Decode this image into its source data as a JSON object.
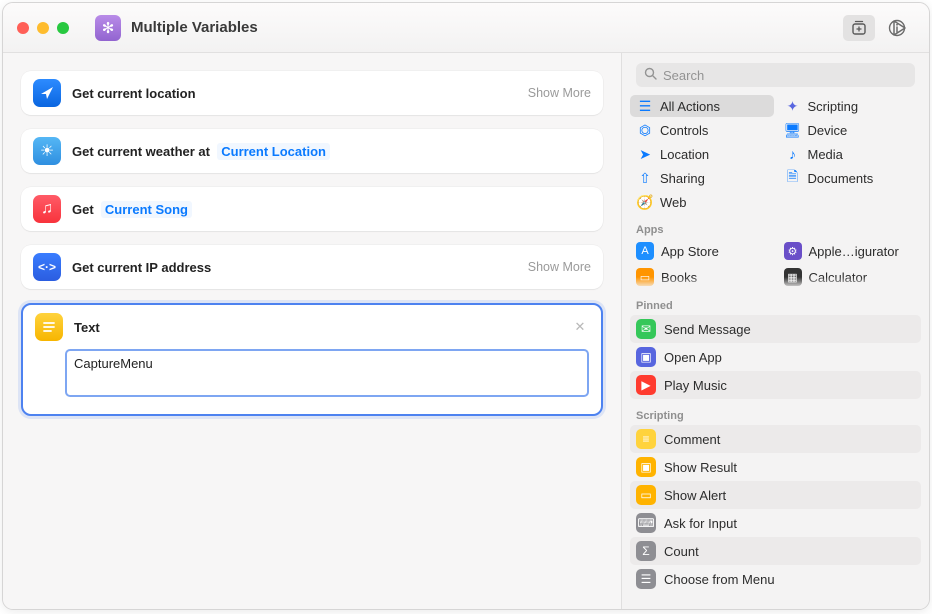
{
  "toolbar": {
    "title": "Multiple Variables",
    "share_icon": "⇧",
    "run_icon": "▷",
    "library_icon": "⊞",
    "info_icon": "ⓘ"
  },
  "actions": [
    {
      "label": "Get current location",
      "icon": "➤",
      "icon_class": "ai-blue",
      "show_more": "Show More",
      "token": null
    },
    {
      "label": "Get current weather at",
      "icon": "☁︎",
      "icon_class": "ai-weather",
      "show_more": null,
      "token": "Current Location"
    },
    {
      "label": "Get",
      "icon": "♫",
      "icon_class": "ai-music",
      "show_more": null,
      "token": "Current Song"
    },
    {
      "label": "Get current IP address",
      "icon": "‹›",
      "icon_class": "ai-ip",
      "show_more": "Show More",
      "token": null
    }
  ],
  "text_action": {
    "label": "Text",
    "value": "CaptureMenu"
  },
  "sidebar": {
    "search_placeholder": "Search",
    "categories": [
      {
        "label": "All Actions",
        "icon": "≡",
        "color": "blue",
        "selected": true
      },
      {
        "label": "Scripting",
        "icon": "✦",
        "color": "indigo",
        "selected": false
      },
      {
        "label": "Controls",
        "icon": "◧",
        "color": "blue",
        "selected": false
      },
      {
        "label": "Device",
        "icon": "🖥",
        "color": "blue",
        "selected": false
      },
      {
        "label": "Location",
        "icon": "➤",
        "color": "blue",
        "selected": false
      },
      {
        "label": "Media",
        "icon": "♪",
        "color": "blue",
        "selected": false
      },
      {
        "label": "Sharing",
        "icon": "⇧",
        "color": "blue",
        "selected": false
      },
      {
        "label": "Documents",
        "icon": "🗎",
        "color": "blue",
        "selected": false
      },
      {
        "label": "Web",
        "icon": "🧭",
        "color": "blue",
        "selected": false
      }
    ],
    "apps_label": "Apps",
    "apps": [
      {
        "label": "App Store",
        "icon": "A",
        "bg": "#1e8fff"
      },
      {
        "label": "Apple…igurator",
        "icon": "⚙",
        "bg": "#6a4fc8"
      },
      {
        "label": "Books",
        "icon": "📖",
        "bg": "#ff9500"
      },
      {
        "label": "Calculator",
        "icon": "∑",
        "bg": "#333333"
      }
    ],
    "pinned_label": "Pinned",
    "pinned": [
      {
        "label": "Send Message",
        "icon": "✉︎",
        "bg": "#35c759"
      },
      {
        "label": "Open App",
        "icon": "▣",
        "bg": "#5866df"
      },
      {
        "label": "Play Music",
        "icon": "▶",
        "bg": "#ff3b2f"
      }
    ],
    "scripting_label": "Scripting",
    "scripting": [
      {
        "label": "Comment",
        "icon": "≡",
        "bg": "#ffd33d"
      },
      {
        "label": "Show Result",
        "icon": "▣",
        "bg": "#ffb300"
      },
      {
        "label": "Show Alert",
        "icon": "!",
        "bg": "#ffb300"
      },
      {
        "label": "Ask for Input",
        "icon": "⌨",
        "bg": "#8e8e93"
      },
      {
        "label": "Count",
        "icon": "Σ",
        "bg": "#8e8e93"
      },
      {
        "label": "Choose from Menu",
        "icon": "☰",
        "bg": "#8e8e93"
      }
    ]
  }
}
